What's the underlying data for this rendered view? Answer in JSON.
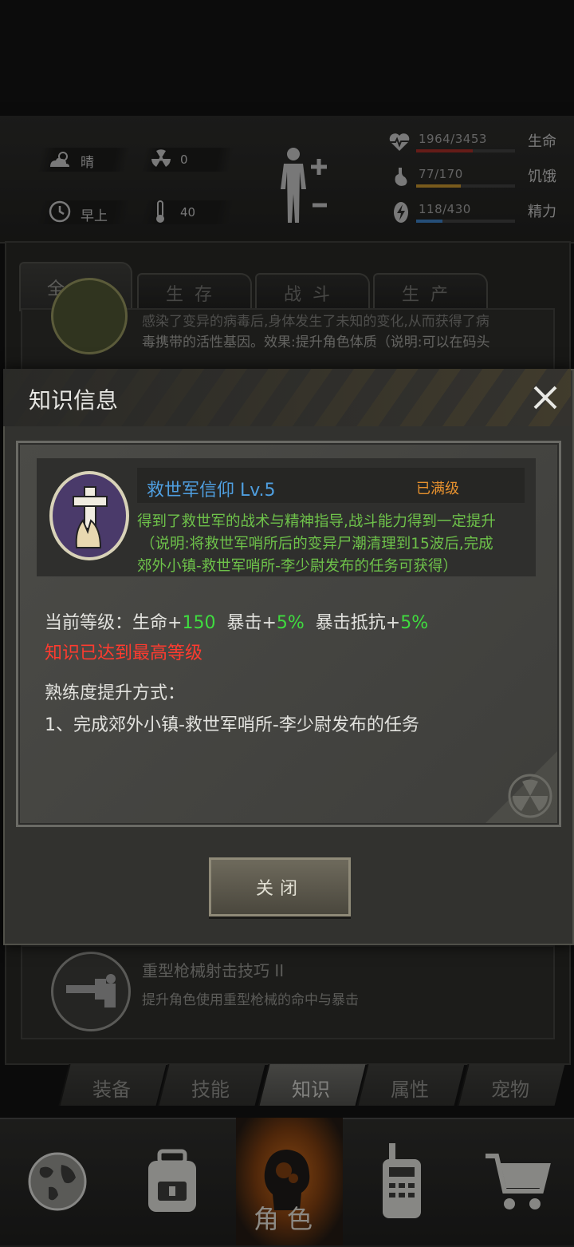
{
  "status": {
    "weather": "晴",
    "radiation": "0",
    "time_of_day": "早上",
    "temperature": "40",
    "stats": [
      {
        "value": "1964/3453",
        "label": "生命",
        "fill": 0.57,
        "color": "#9b2b25",
        "icon": "heart-pulse-icon"
      },
      {
        "value": "77/170",
        "label": "饥饿",
        "fill": 0.45,
        "color": "#b88a2c",
        "icon": "stomach-icon"
      },
      {
        "value": "118/430",
        "label": "精力",
        "fill": 0.27,
        "color": "#3a78b8",
        "icon": "energy-bolt-icon"
      }
    ]
  },
  "category_tabs": [
    "全部",
    "生存",
    "战斗",
    "生产"
  ],
  "list_items": [
    {
      "text_line1": "感染了变异的病毒后,身体发生了未知的变化,从而获得了病",
      "text_line2": "毒携带的活性基因。效果:提升角色体质（说明:可以在码头"
    },
    {
      "title": "重型枪械射击技巧 II",
      "desc": "提升角色使用重型枪械的命中与暴击"
    }
  ],
  "modal": {
    "title": "知识信息",
    "skill_name": "救世军信仰 Lv.5",
    "status": "已满级",
    "desc_lines": [
      "得到了救世军的战术与精神指导,战斗能力得到一定提升",
      "（说明:将救世军哨所后的变异尸潮清理到15波后,完成",
      "郊外小镇-救世军哨所-李少尉发布的任务可获得）"
    ],
    "current_level_prefix": "当前等级：",
    "stat_hp_label": "生命+",
    "stat_hp_value": "150",
    "stat_crit_label": "暴击+",
    "stat_crit_value": "5%",
    "stat_critres_label": "暴击抵抗+",
    "stat_critres_value": "5%",
    "max_level_notice": "知识已达到最高等级",
    "proficiency_heading": "熟练度提升方式：",
    "proficiency_item": "1、完成郊外小镇-救世军哨所-李少尉发布的任务",
    "close_button": "关闭"
  },
  "section_tabs": [
    {
      "label": "装备",
      "active": false
    },
    {
      "label": "技能",
      "active": false
    },
    {
      "label": "知识",
      "active": true
    },
    {
      "label": "属性",
      "active": false
    },
    {
      "label": "宠物",
      "active": false
    }
  ],
  "nav": {
    "active_label": "角色",
    "items": [
      "globe-icon",
      "backpack-icon",
      "character-head-icon",
      "walkie-talkie-icon",
      "shopping-cart-icon"
    ]
  }
}
